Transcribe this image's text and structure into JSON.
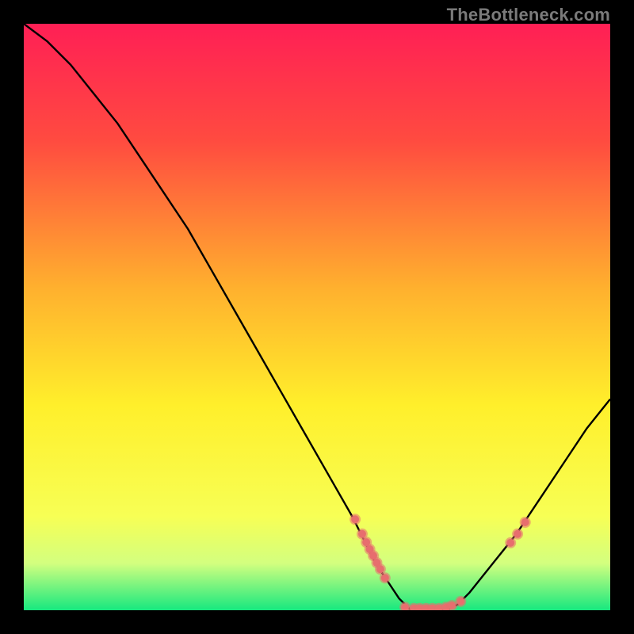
{
  "watermark": "TheBottleneck.com",
  "chart_data": {
    "type": "line",
    "title": "",
    "xlabel": "",
    "ylabel": "",
    "xlim": [
      0,
      100
    ],
    "ylim": [
      0,
      100
    ],
    "gradient_stops": [
      {
        "offset": 0,
        "color": "#ff1f55"
      },
      {
        "offset": 20,
        "color": "#ff4b40"
      },
      {
        "offset": 45,
        "color": "#ffb02e"
      },
      {
        "offset": 65,
        "color": "#ffef2b"
      },
      {
        "offset": 84,
        "color": "#f7ff55"
      },
      {
        "offset": 92,
        "color": "#d3ff7f"
      },
      {
        "offset": 100,
        "color": "#17e87f"
      }
    ],
    "series": [
      {
        "name": "bottleneck-curve",
        "x": [
          0,
          4,
          8,
          12,
          16,
          20,
          24,
          28,
          32,
          36,
          40,
          44,
          48,
          52,
          56,
          60,
          62,
          64,
          66,
          68,
          70,
          72,
          74,
          76,
          80,
          84,
          88,
          92,
          96,
          100
        ],
        "y": [
          100,
          97,
          93,
          88,
          83,
          77,
          71,
          65,
          58,
          51,
          44,
          37,
          30,
          23,
          16,
          8,
          5,
          2,
          0,
          0,
          0,
          0,
          1,
          3,
          8,
          13,
          19,
          25,
          31,
          36
        ]
      }
    ],
    "markers": [
      {
        "x": 56.5,
        "y": 15.5
      },
      {
        "x": 57.7,
        "y": 13.0
      },
      {
        "x": 58.4,
        "y": 11.6
      },
      {
        "x": 59.0,
        "y": 10.4
      },
      {
        "x": 59.6,
        "y": 9.3
      },
      {
        "x": 60.2,
        "y": 8.1
      },
      {
        "x": 60.8,
        "y": 7.0
      },
      {
        "x": 61.6,
        "y": 5.5
      },
      {
        "x": 65.0,
        "y": 0.5
      },
      {
        "x": 66.5,
        "y": 0.3
      },
      {
        "x": 67.5,
        "y": 0.3
      },
      {
        "x": 68.6,
        "y": 0.3
      },
      {
        "x": 69.7,
        "y": 0.3
      },
      {
        "x": 70.8,
        "y": 0.3
      },
      {
        "x": 72.0,
        "y": 0.5
      },
      {
        "x": 73.0,
        "y": 0.8
      },
      {
        "x": 74.5,
        "y": 1.5
      },
      {
        "x": 83.0,
        "y": 11.5
      },
      {
        "x": 84.2,
        "y": 13.0
      },
      {
        "x": 85.5,
        "y": 15.0
      }
    ],
    "marker_style": {
      "fill": "#e76e6e",
      "r_outer": 7,
      "r_inner": 5
    }
  }
}
